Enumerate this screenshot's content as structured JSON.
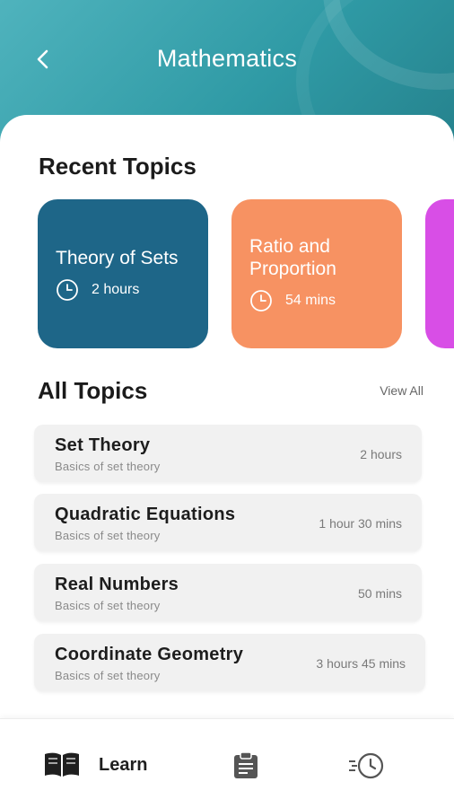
{
  "header": {
    "title": "Mathematics",
    "back_icon": "chevron-left-icon",
    "color_start": "#4fb3bd",
    "color_end": "#247f8a"
  },
  "recent": {
    "title": "Recent Topics",
    "cards": [
      {
        "title": "Theory of Sets",
        "duration": "2 hours",
        "color": "#1e6688",
        "icon": "clock-icon"
      },
      {
        "title": "Ratio and Proportion",
        "duration": "54 mins",
        "color": "#f79262",
        "icon": "clock-icon"
      },
      {
        "title": "",
        "duration": "",
        "color": "#d84ee6"
      }
    ]
  },
  "all": {
    "title": "All Topics",
    "view_all": "View All",
    "topics": [
      {
        "title": "Set Theory",
        "subtitle": "Basics of set theory",
        "duration": "2 hours"
      },
      {
        "title": "Quadratic Equations",
        "subtitle": "Basics of set theory",
        "duration": "1 hour 30 mins"
      },
      {
        "title": "Real Numbers",
        "subtitle": "Basics of set theory",
        "duration": "50 mins"
      },
      {
        "title": "Coordinate Geometry",
        "subtitle": "Basics of set theory",
        "duration": "3 hours 45 mins"
      }
    ]
  },
  "nav": {
    "learn_label": "Learn",
    "learn_icon": "book-icon",
    "tasks_icon": "clipboard-icon",
    "history_icon": "history-clock-icon"
  }
}
